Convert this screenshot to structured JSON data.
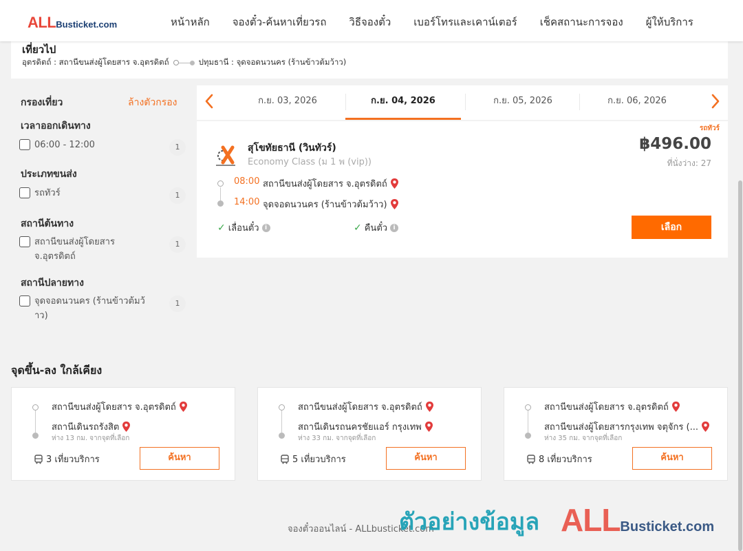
{
  "logo": {
    "all": "ALL",
    "rest": "Busticket.com"
  },
  "nav": [
    "หน้าหลัก",
    "จองตั๋ว-ค้นหาเที่ยวรถ",
    "วิธีจองตั๋ว",
    "เบอร์โทรและเคาน์เตอร์",
    "เช็คสถานะการจอง",
    "ผู้ให้บริการ"
  ],
  "trip": {
    "title": "เที่ยวไป",
    "from": "อุตรดิตถ์ : สถานีขนส่งผู้โดยสาร จ.อุตรดิตถ์",
    "to": "ปทุมธานี : จุดจอดนวนคร (ร้านข้าวต้มว้าว)"
  },
  "filter": {
    "title": "กรองเที่ยว",
    "clear": "ล้างตัวกรอง",
    "sections": [
      {
        "title": "เวลาออกเดินทาง",
        "option": "06:00 - 12:00",
        "count": "1"
      },
      {
        "title": "ประเภทขนส่ง",
        "option": "รถทัวร์",
        "count": "1"
      },
      {
        "title": "สถานีต้นทาง",
        "option": "สถานีขนส่งผู้โดยสาร จ.อุตรดิตถ์",
        "count": "1"
      },
      {
        "title": "สถานีปลายทาง",
        "option": "จุดจอดนวนคร (ร้านข้าวต้มว้าว)",
        "count": "1"
      }
    ]
  },
  "dates": [
    "ก.ย. 03, 2026",
    "ก.ย. 04, 2026",
    "ก.ย. 05, 2026",
    "ก.ย. 06, 2026"
  ],
  "active_date_index": 1,
  "result": {
    "tag": "รถทัวร์",
    "operator": "สุโขทัยธานี (วินทัวร์)",
    "class": "Economy Class (ม 1 พ (vip))",
    "price": "฿496.00",
    "seats": "ที่นั่งว่าง: 27",
    "depart_time": "08:00",
    "depart_stop": "สถานีขนส่งผู้โดยสาร จ.อุตรดิตถ์",
    "arrive_time": "14:00",
    "arrive_stop": "จุดจอดนวนคร (ร้านข้าวต้มว้าว)",
    "feature1": "เลื่อนตั๋ว",
    "feature2": "คืนตั๋ว",
    "select": "เลือก"
  },
  "nearby": {
    "title": "จุดขึ้น-ลง ใกล้เคียง",
    "cards": [
      {
        "from": "สถานีขนส่งผู้โดยสาร จ.อุตรดิตถ์",
        "to": "สถานีเดินรถรังสิต",
        "dist": "ห่าง 13 กม. จากจุดที่เลือก",
        "trips": "3 เที่ยวบริการ",
        "btn": "ค้นหา"
      },
      {
        "from": "สถานีขนส่งผู้โดยสาร จ.อุตรดิตถ์",
        "to": "สถานีเดินรถนครชัยแอร์ กรุงเทพ",
        "dist": "ห่าง 33 กม. จากจุดที่เลือก",
        "trips": "5 เที่ยวบริการ",
        "btn": "ค้นหา"
      },
      {
        "from": "สถานีขนส่งผู้โดยสาร จ.อุตรดิตถ์",
        "to": "สถานีขนส่งผู้โดยสารกรุงเทพ จตุจักร (...",
        "dist": "ห่าง 35 กม. จากจุดที่เลือก",
        "trips": "8 เที่ยวบริการ",
        "btn": "ค้นหา"
      }
    ]
  },
  "footer": "จองตั๋วออนไลน์ - ALLbusticket.com",
  "watermark": {
    "text": "ตัวอย่างข้อมูล",
    "all": "ALL",
    "rest": "Busticket.com"
  },
  "colors": {
    "accent": "#f37021",
    "button": "#ff6a00",
    "check": "#3aa84a",
    "pin": "#e23b3b"
  }
}
